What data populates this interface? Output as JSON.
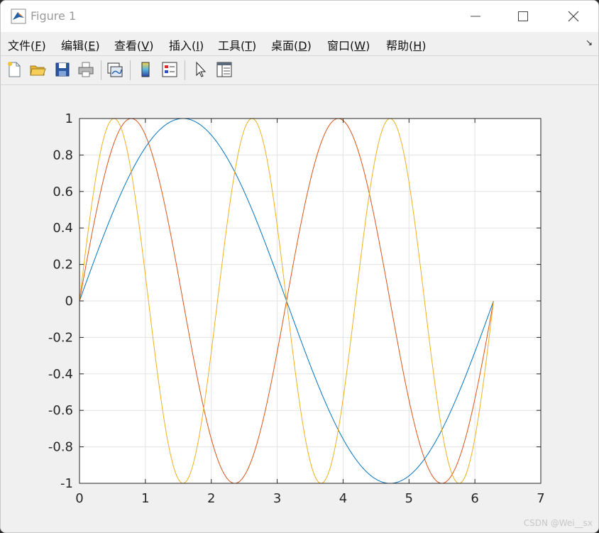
{
  "window": {
    "title": "Figure 1"
  },
  "menu": [
    {
      "label": "文件(",
      "key": "F",
      "tail": ")"
    },
    {
      "label": "编辑(",
      "key": "E",
      "tail": ")"
    },
    {
      "label": "查看(",
      "key": "V",
      "tail": ")"
    },
    {
      "label": "插入(",
      "key": "I",
      "tail": ")"
    },
    {
      "label": "工具(",
      "key": "T",
      "tail": ")"
    },
    {
      "label": "桌面(",
      "key": "D",
      "tail": ")"
    },
    {
      "label": "窗口(",
      "key": "W",
      "tail": ")"
    },
    {
      "label": "帮助(",
      "key": "H",
      "tail": ")"
    }
  ],
  "toolbar": {
    "icons": [
      "new-figure-icon",
      "open-file-icon",
      "save-icon",
      "print-icon",
      "link-plot-icon",
      "colorbar-icon",
      "legend-icon",
      "pointer-icon",
      "property-inspector-icon"
    ]
  },
  "watermark": "CSDN @Wei__sx",
  "chart_data": {
    "type": "line",
    "title": "",
    "xlabel": "",
    "ylabel": "",
    "xlim": [
      0,
      7
    ],
    "ylim": [
      -1,
      1
    ],
    "xticks": [
      0,
      1,
      2,
      3,
      4,
      5,
      6,
      7
    ],
    "yticks": [
      -1,
      -0.8,
      -0.6,
      -0.4,
      -0.2,
      0,
      0.2,
      0.4,
      0.6,
      0.8,
      1
    ],
    "grid": true,
    "x_range": [
      0,
      6.2832
    ],
    "series": [
      {
        "function": "sin(x)",
        "frequency": 1,
        "color": "#0072BD"
      },
      {
        "function": "sin(2x)",
        "frequency": 2,
        "color": "#D95319"
      },
      {
        "function": "sin(3x)",
        "frequency": 3,
        "color": "#EDB120"
      }
    ]
  }
}
